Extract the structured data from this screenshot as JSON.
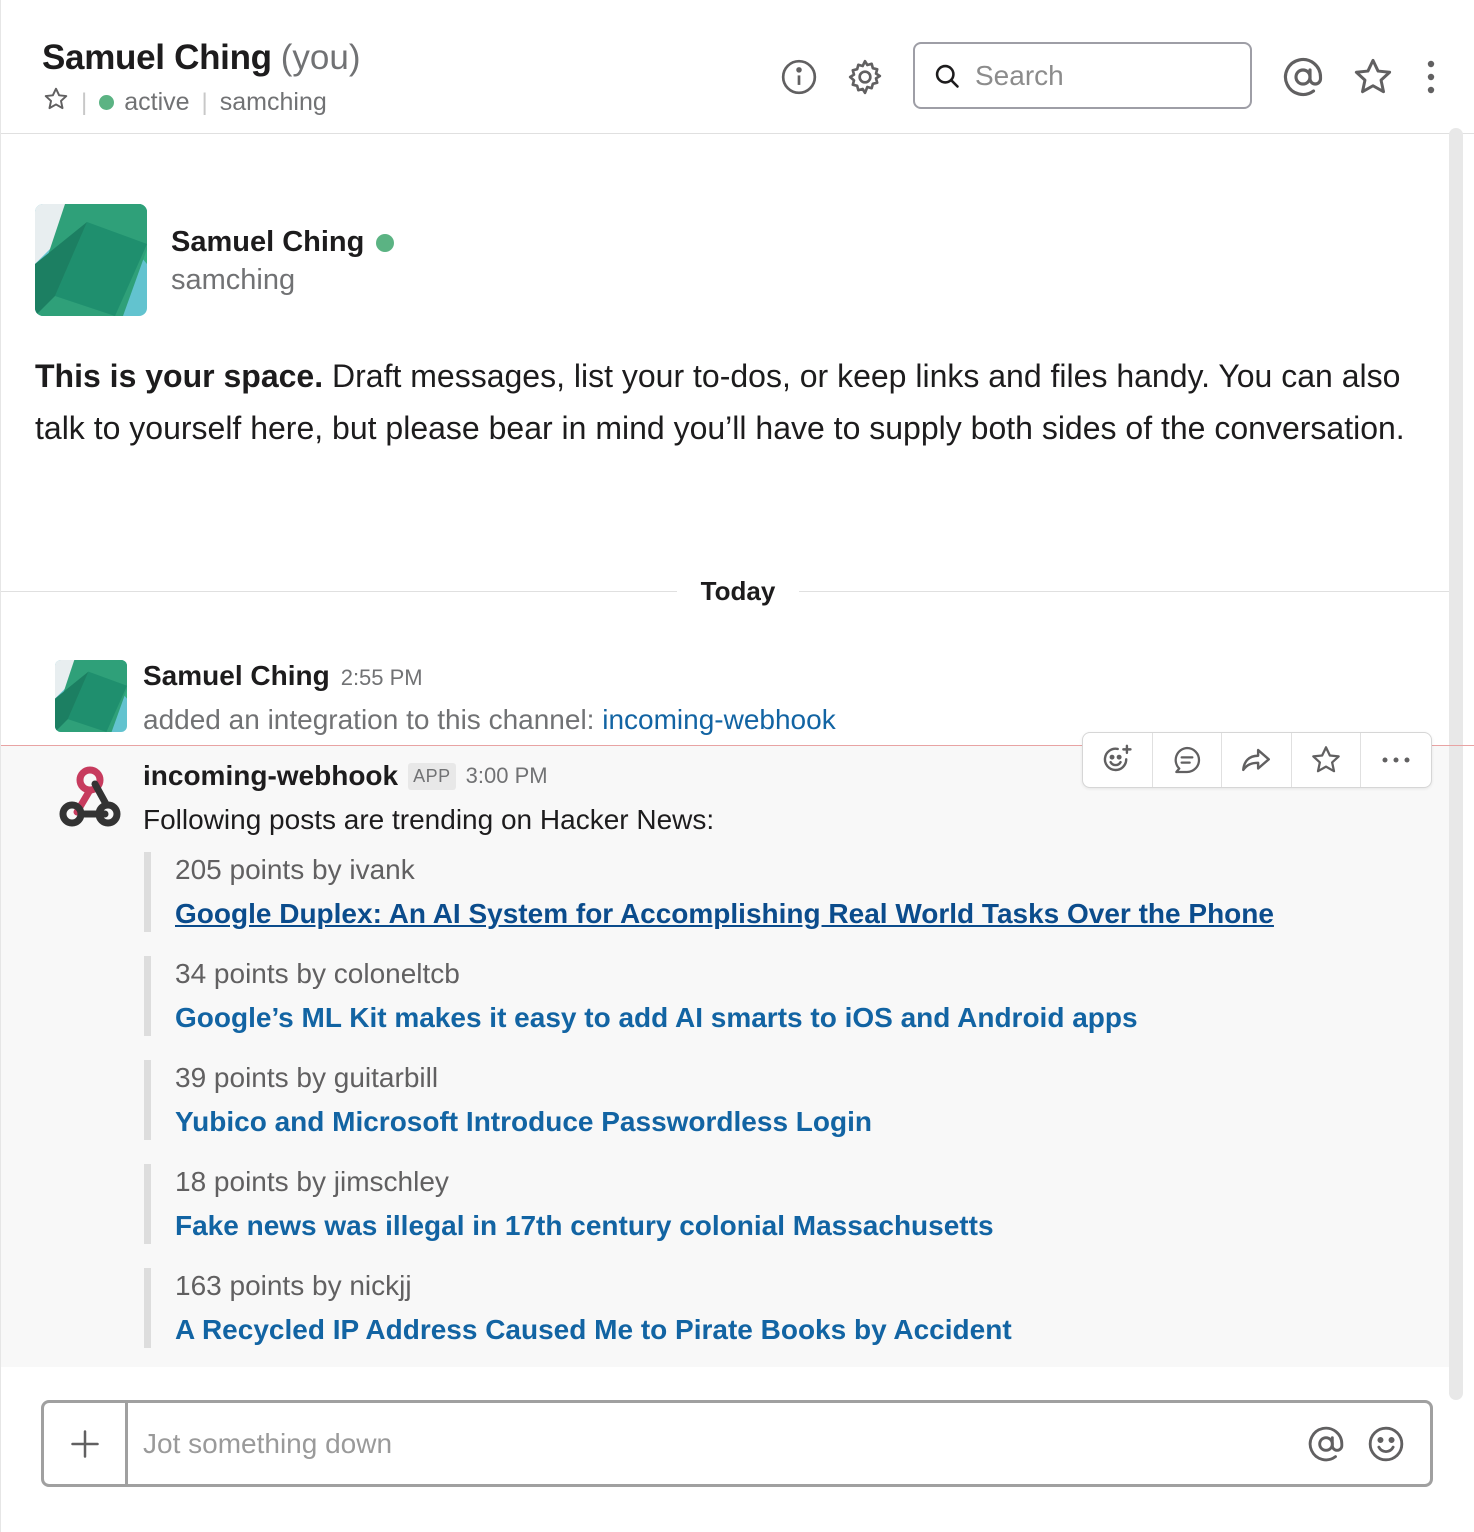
{
  "header": {
    "name": "Samuel Ching",
    "you_label": "(you)",
    "status": "active",
    "handle": "samching",
    "search_placeholder": "Search"
  },
  "intro": {
    "name": "Samuel Ching",
    "handle": "samching",
    "bold_text": "This is your space.",
    "text": " Draft messages, list your to-dos, or keep links and files handy. You can also talk to yourself here, but please bear in mind you’ll have to supply both sides of the conversation."
  },
  "divider": {
    "label": "Today"
  },
  "messages": [
    {
      "author": "Samuel Ching",
      "time": "2:55 PM",
      "text": "added an integration to this channel: ",
      "link": "incoming-webhook"
    },
    {
      "author": "incoming-webhook",
      "badge": "APP",
      "time": "3:00 PM",
      "text": "Following posts are trending on Hacker News:",
      "attachments": [
        {
          "points": "205 points by ivank",
          "title": "Google Duplex: An AI System for Accomplishing Real World Tasks Over the Phone"
        },
        {
          "points": "34 points by coloneltcb",
          "title": "Google’s ML Kit makes it easy to add AI smarts to iOS and Android apps"
        },
        {
          "points": "39 points by guitarbill",
          "title": "Yubico and Microsoft Introduce Passwordless Login"
        },
        {
          "points": "18 points by jimschley",
          "title": "Fake news was illegal in 17th century colonial Massachusetts"
        },
        {
          "points": "163 points by nickjj",
          "title": "A Recycled IP Address Caused Me to Pirate Books by Accident"
        }
      ]
    }
  ],
  "toolbar": [
    "add-reaction-icon",
    "start-thread-icon",
    "share-icon",
    "star-icon",
    "more-actions-icon"
  ],
  "composer": {
    "placeholder": "Jot something down"
  },
  "colors": {
    "link": "#1264a3",
    "presence": "#5bb383",
    "new_divider": "#e8a3a3"
  }
}
